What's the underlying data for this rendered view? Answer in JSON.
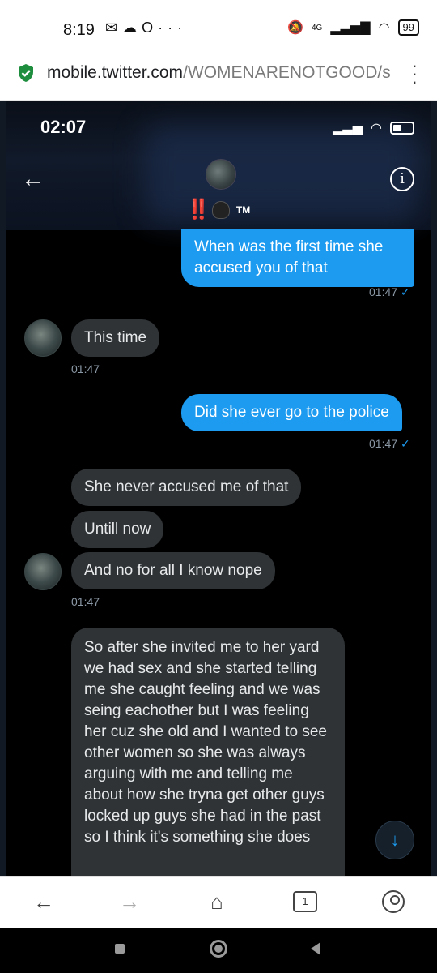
{
  "status_bar": {
    "time": "8:19",
    "left_icons": [
      "mail-icon",
      "cloud-icon",
      "opera-icon",
      "more-dots-icon"
    ],
    "network": "4G",
    "battery": "99"
  },
  "url_bar": {
    "host": "mobile.twitter.com",
    "path": "/WOMENARENOTGOOD/s",
    "secure_color": "#1e8e3e"
  },
  "chat": {
    "inner_time": "02:07",
    "header": {
      "emoji_bangs": "‼️",
      "tm": "TM"
    },
    "messages": [
      {
        "dir": "sent",
        "text": "When was the first time she accused you of that"
      },
      {
        "dir": "sent-ts",
        "text": "01:47"
      },
      {
        "dir": "recv",
        "text": "This time"
      },
      {
        "dir": "recv-ts",
        "text": "01:47"
      },
      {
        "dir": "sent",
        "text": "Did she ever go to the police"
      },
      {
        "dir": "sent-ts",
        "text": "01:47"
      },
      {
        "dir": "recv",
        "text": "She never accused me of that"
      },
      {
        "dir": "recv",
        "text": "Untill now"
      },
      {
        "dir": "recv",
        "text": "And no for all I know nope"
      },
      {
        "dir": "recv-ts",
        "text": "01:47"
      },
      {
        "dir": "recv",
        "text": "So after she invited me to her yard we had sex and she started telling me she caught feeling and we was seing eachother but I was feeling her cuz she old and I wanted to see other women so she was always arguing with me and telling me about how she tryna get other guys locked up guys she had in the past so I think it's something she does"
      }
    ],
    "check_mark": "✓",
    "sent_color": "#1d9bf0",
    "recv_color": "#2f3336"
  },
  "nav_bar": {
    "tab_count": "1"
  }
}
